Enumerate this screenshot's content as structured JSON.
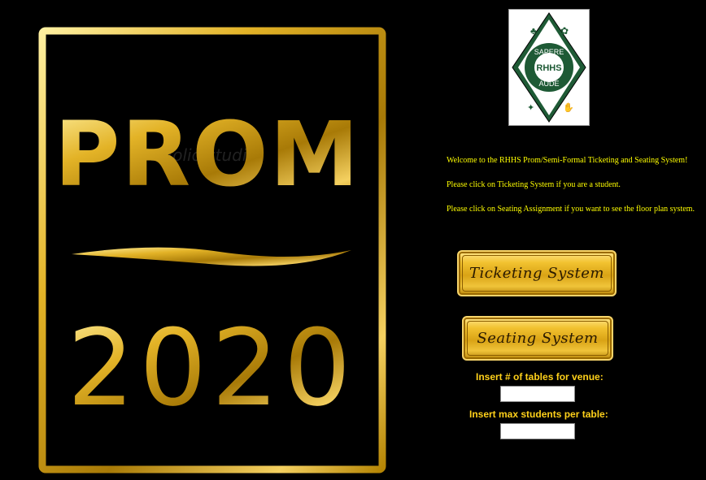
{
  "poster": {
    "word": "PROM",
    "year": "2020",
    "watermark": "pickfolio studio"
  },
  "crest": {
    "top_text": "SAPERE",
    "center_text": "RHHS",
    "bottom_text": "AUDE"
  },
  "info": {
    "welcome": "Welcome to the RHHS Prom/Semi-Formal Ticketing and Seating System!",
    "ticket_hint": "Please click on Ticketing System if you are a student.",
    "seating_hint": "Please click on Seating Assignment if you want to see the floor plan system."
  },
  "buttons": {
    "ticketing": "Ticketing System",
    "seating": "Seating System"
  },
  "form": {
    "tables_label": "Insert # of tables for venue:",
    "tables_value": "",
    "max_label": "Insert max students per table:",
    "max_value": ""
  },
  "colors": {
    "gold": "#d9a315",
    "info_text": "#ffff00",
    "label_text": "#ffd11a",
    "crest_green": "#1e5a35"
  }
}
